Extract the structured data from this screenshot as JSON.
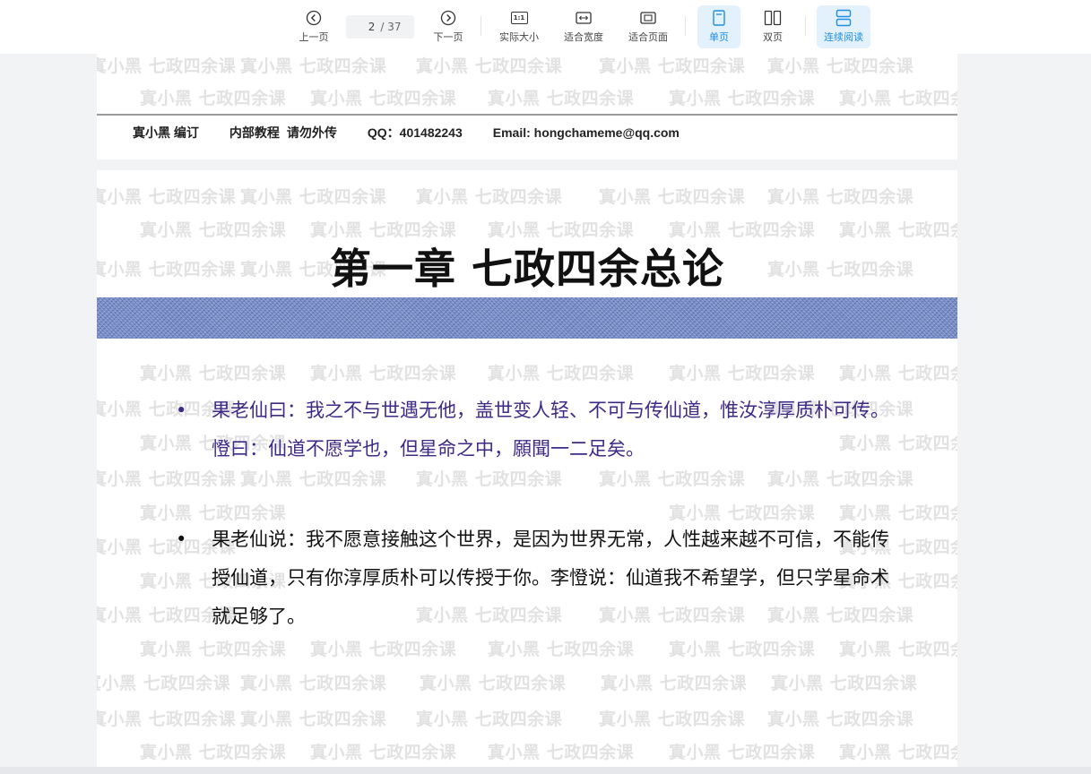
{
  "toolbar": {
    "prev_label": "上一页",
    "current_page": "2",
    "total_pages": "/ 37",
    "next_label": "下一页",
    "actual_size_label": "实际大小",
    "actual_size_icon_text": "1:1",
    "fit_width_label": "适合宽度",
    "fit_page_label": "适合页面",
    "single_page_label": "单页",
    "double_page_label": "双页",
    "continuous_label": "连续阅读",
    "accent_color": "#1e8ee0",
    "active_bg": "#e3f1fc"
  },
  "watermark": "寘小黑 七政四余课",
  "page_header": {
    "editor": "寘小黑 编订",
    "internal": "内部教程",
    "no_share": "请勿外传",
    "qq": "QQ：401482243",
    "email": "Email: hongchameme@qq.com"
  },
  "chapter": {
    "title": "第一章  七政四余总论"
  },
  "paragraphs": [
    {
      "bullet": "•",
      "text": "果老仙曰：我之不与世遇无他，盖世变人轻、不可与传仙道，惟汝淳厚质朴可传。憕曰：仙道不愿学也，但星命之中，願聞一二足矣。",
      "color": "#3e2a86"
    },
    {
      "bullet": "•",
      "text": "果老仙说：我不愿意接触这个世界，是因为世界无常，人性越来越不可信，不能传授仙道，只有你淳厚质朴可以传授于你。李憕说：仙道我不希望学，但只学星命术就足够了。",
      "color": "#111111"
    }
  ]
}
